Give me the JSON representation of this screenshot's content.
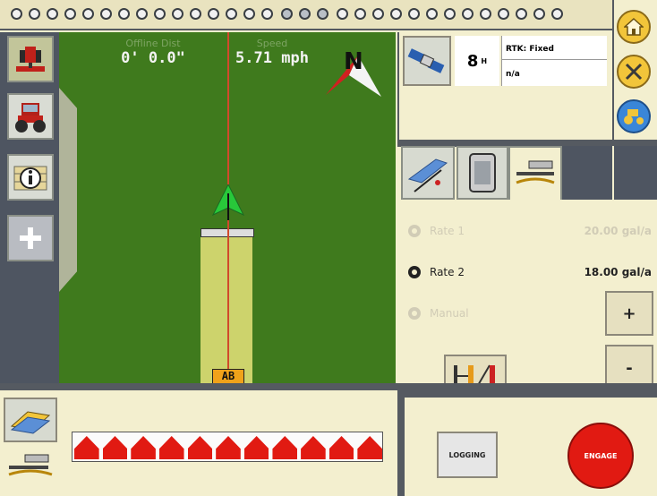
{
  "guidance": {
    "offline_label": "Offline Dist",
    "offline_value": "0' 0.0\"",
    "speed_label": "Speed",
    "speed_value": "5.71 mph",
    "compass_letter": "N",
    "ab_marker": "AB"
  },
  "gps": {
    "satellites": "8",
    "superscript": "H",
    "mode": "RTK: Fixed",
    "status": "n/a"
  },
  "rates": [
    {
      "label": "Rate 1",
      "value": "20.00 gal/a",
      "active": false
    },
    {
      "label": "Rate 2",
      "value": "18.00 gal/a",
      "active": true
    },
    {
      "label": "Manual",
      "value": "",
      "active": false
    }
  ],
  "buttons": {
    "increase": "+",
    "decrease": "-",
    "logging": "LOGGING",
    "engage": "ENGAGE"
  },
  "section_count": 11,
  "colors": {
    "field": "#3f7a1d",
    "coverage": "#cdd36c",
    "guide_line": "#d14a2b",
    "section": "#e11a12",
    "engage": "#e11a12",
    "bezel": "#4e5561",
    "panel": "#f3efcf"
  },
  "icons": [
    "tractor-implement-icon",
    "tractor-icon",
    "info-icon",
    "plus-icon",
    "home-icon",
    "tools-icon",
    "vehicle-icon",
    "satellite-icon",
    "ab-line-icon",
    "display-icon",
    "sprayer-icon",
    "swath-icon",
    "sprayer-small-icon",
    "boom-width-icon"
  ]
}
